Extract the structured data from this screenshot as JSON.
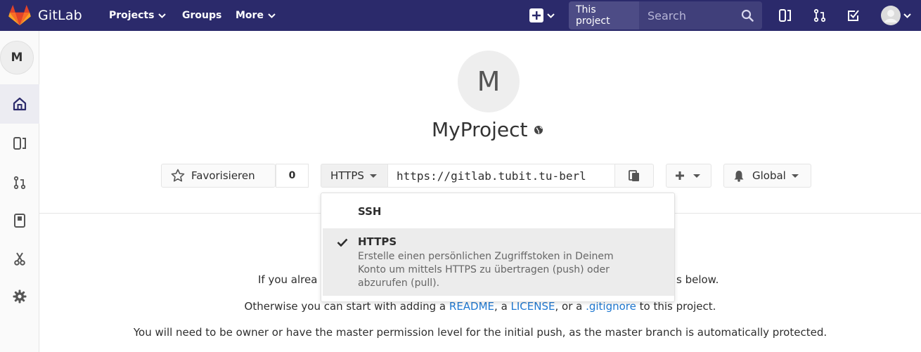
{
  "navbar": {
    "brand": "GitLab",
    "projects": "Projects",
    "groups": "Groups",
    "more": "More",
    "search_scope": "This project",
    "search_placeholder": "Search"
  },
  "sidebar": {
    "avatar_letter": "M"
  },
  "project": {
    "avatar_letter": "M",
    "name": "MyProject",
    "star_label": "Favorisieren",
    "star_count": "0",
    "clone_protocol": "HTTPS",
    "clone_url": "https://gitlab.tubit.tu-berl",
    "notification_label": "Global"
  },
  "clone_dropdown": {
    "items": [
      {
        "title": "SSH",
        "selected": false
      },
      {
        "title": "HTTPS",
        "selected": true,
        "description": "Erstelle einen persönlichen Zugriffstoken in Deinem Konto um mittels HTTPS zu übertragen (push) oder abzurufen (pull)."
      }
    ]
  },
  "empty_state": {
    "line1_start": "If you alrea",
    "line1_end": "s below.",
    "line2_pre": "Otherwise you can start with adding a ",
    "readme": "README",
    "sep1": ", a ",
    "license": "LICENSE",
    "sep2": ", or a ",
    "gitignore": ".gitignore",
    "line2_post": " to this project.",
    "line3": "You will need to be owner or have the master permission level for the initial push, as the master branch is automatically protected."
  },
  "colors": {
    "navbar": "#2b2a6b",
    "link": "#1f78d1"
  }
}
